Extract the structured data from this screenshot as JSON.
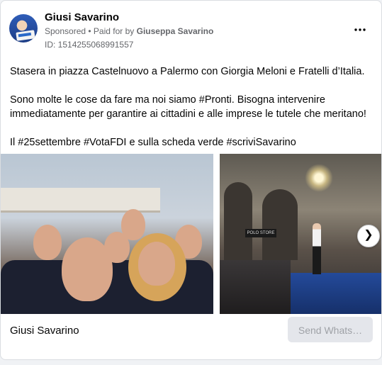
{
  "post": {
    "page_name": "Giusi Savarino",
    "sponsored_label": "Sponsored",
    "separator": " • ",
    "paid_for_label": "Paid for by ",
    "paid_for_name": "Giuseppa Savarino",
    "ad_id": "ID: 1514255068991557",
    "more_icon": "more-horizontal-icon",
    "text": {
      "paragraph_1": "Stasera in piazza Castelnuovo a Palermo con Giorgia Meloni e Fratelli d’Italia.",
      "paragraph_2": "Sono molte le cose da fare ma noi siamo #Pronti. Bisogna intervenire immediatamente per garantire ai cittadini e alle imprese le tutele che meritano!",
      "paragraph_3": "Il #25settembre #VotaFDI e sulla scheda verde #scriviSavarino"
    }
  },
  "carousel": {
    "next_icon": "chevron-right-icon",
    "next_glyph": "❯",
    "store_sign": "POLO STORE"
  },
  "footer": {
    "name": "Giusi Savarino",
    "cta_label": "Send Whats…"
  },
  "colors": {
    "text_primary": "#050505",
    "text_secondary": "#65676b",
    "button_bg": "#e4e6eb",
    "button_text": "#9fa2a7"
  }
}
